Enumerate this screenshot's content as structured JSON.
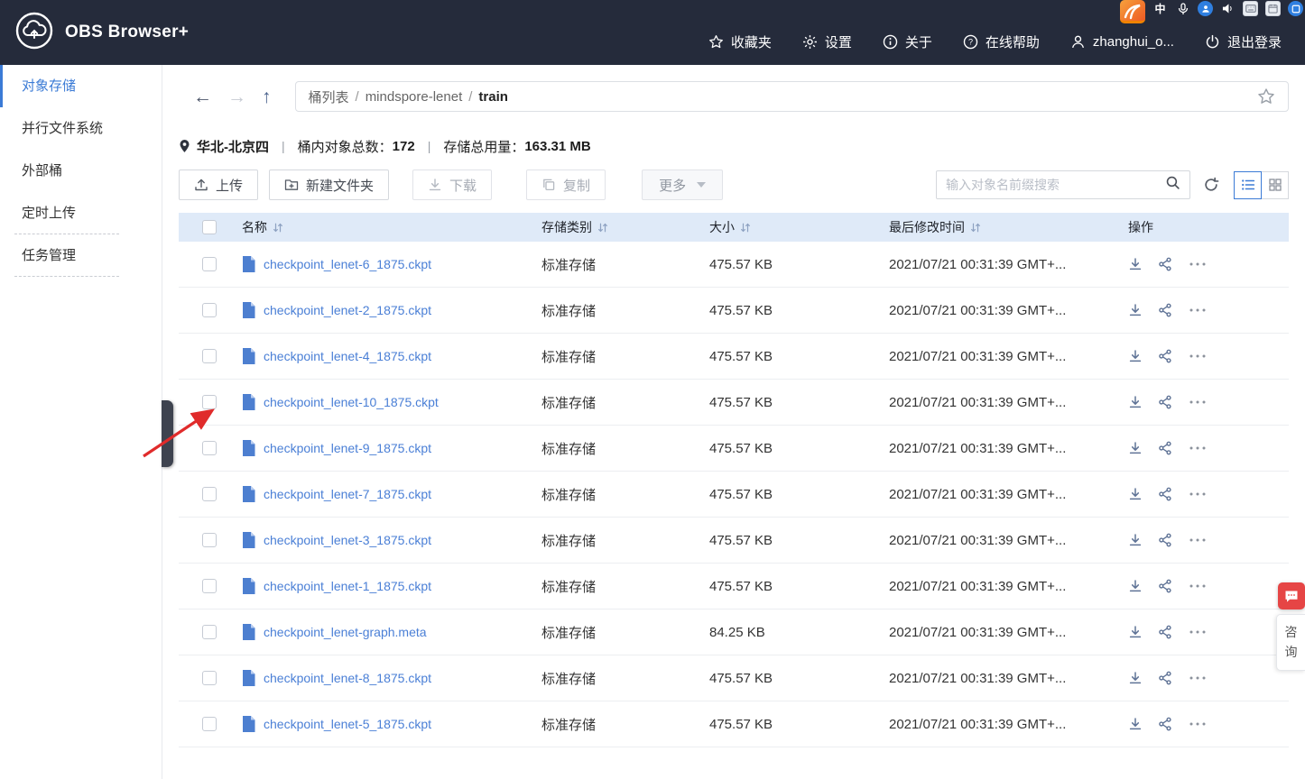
{
  "os_overlay": {
    "ime_indicator": "中"
  },
  "header": {
    "app_title": "OBS Browser+",
    "nav": [
      {
        "label": "收藏夹",
        "icon": "star"
      },
      {
        "label": "设置",
        "icon": "gear"
      },
      {
        "label": "关于",
        "icon": "info"
      },
      {
        "label": "在线帮助",
        "icon": "help"
      },
      {
        "label": "zhanghui_o...",
        "icon": "user"
      },
      {
        "label": "退出登录",
        "icon": "power"
      }
    ]
  },
  "sidebar": {
    "items": [
      {
        "label": "对象存储",
        "active": true
      },
      {
        "label": "并行文件系统",
        "active": false
      },
      {
        "label": "外部桶",
        "active": false
      },
      {
        "label": "定时上传",
        "active": false
      },
      {
        "label": "任务管理",
        "active": false
      }
    ]
  },
  "breadcrumb": {
    "segments": [
      "桶列表",
      "mindspore-lenet",
      "train"
    ],
    "separator": "/"
  },
  "info_bar": {
    "region": "华北-北京四",
    "divider": "|",
    "object_count_label": "桶内对象总数：",
    "object_count": "172",
    "storage_label": "存储总用量：",
    "storage_total": "163.31 MB"
  },
  "toolbar": {
    "upload": "上传",
    "new_folder": "新建文件夹",
    "download": "下载",
    "copy": "复制",
    "more": "更多",
    "search_placeholder": "输入对象名前缀搜索"
  },
  "table": {
    "headers": {
      "name": "名称",
      "storage_class": "存储类别",
      "size": "大小",
      "modified": "最后修改时间",
      "operation": "操作"
    },
    "rows": [
      {
        "name": "checkpoint_lenet-6_1875.ckpt",
        "storage_class": "标准存储",
        "size": "475.57 KB",
        "modified": "2021/07/21 00:31:39 GMT+..."
      },
      {
        "name": "checkpoint_lenet-2_1875.ckpt",
        "storage_class": "标准存储",
        "size": "475.57 KB",
        "modified": "2021/07/21 00:31:39 GMT+..."
      },
      {
        "name": "checkpoint_lenet-4_1875.ckpt",
        "storage_class": "标准存储",
        "size": "475.57 KB",
        "modified": "2021/07/21 00:31:39 GMT+..."
      },
      {
        "name": "checkpoint_lenet-10_1875.ckpt",
        "storage_class": "标准存储",
        "size": "475.57 KB",
        "modified": "2021/07/21 00:31:39 GMT+..."
      },
      {
        "name": "checkpoint_lenet-9_1875.ckpt",
        "storage_class": "标准存储",
        "size": "475.57 KB",
        "modified": "2021/07/21 00:31:39 GMT+..."
      },
      {
        "name": "checkpoint_lenet-7_1875.ckpt",
        "storage_class": "标准存储",
        "size": "475.57 KB",
        "modified": "2021/07/21 00:31:39 GMT+..."
      },
      {
        "name": "checkpoint_lenet-3_1875.ckpt",
        "storage_class": "标准存储",
        "size": "475.57 KB",
        "modified": "2021/07/21 00:31:39 GMT+..."
      },
      {
        "name": "checkpoint_lenet-1_1875.ckpt",
        "storage_class": "标准存储",
        "size": "475.57 KB",
        "modified": "2021/07/21 00:31:39 GMT+..."
      },
      {
        "name": "checkpoint_lenet-graph.meta",
        "storage_class": "标准存储",
        "size": "84.25 KB",
        "modified": "2021/07/21 00:31:39 GMT+..."
      },
      {
        "name": "checkpoint_lenet-8_1875.ckpt",
        "storage_class": "标准存储",
        "size": "475.57 KB",
        "modified": "2021/07/21 00:31:39 GMT+..."
      },
      {
        "name": "checkpoint_lenet-5_1875.ckpt",
        "storage_class": "标准存储",
        "size": "475.57 KB",
        "modified": "2021/07/21 00:31:39 GMT+..."
      }
    ]
  },
  "chat_widget": {
    "label": "咨询"
  },
  "colors": {
    "accent": "#3b7bd6",
    "header_bg": "#252b3b",
    "table_header_bg": "#dfeaf8",
    "link": "#4a7fd6",
    "annotation_arrow": "#e02b2b",
    "chat_red": "#e64545"
  }
}
